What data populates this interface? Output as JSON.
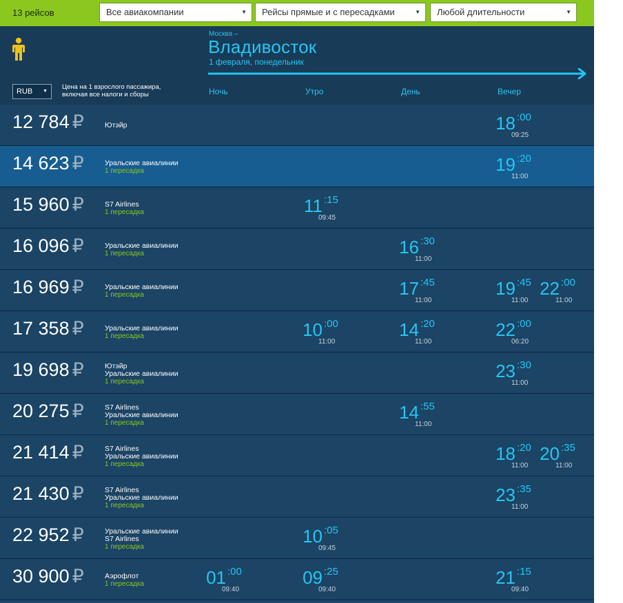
{
  "filters": {
    "count": "13 рейсов",
    "airlines": "Все авиакомпании",
    "stops": "Рейсы прямые и с пересадками",
    "duration": "Любой длительности"
  },
  "header": {
    "from": "Москва –",
    "to": "Владивосток",
    "date": "1 февраля, понедельник",
    "currency": "RUB",
    "price_note_line1": "Цена на 1 взрослого пассажира,",
    "price_note_line2": "включая все налоги и сборы",
    "columns": [
      "Ночь",
      "Утро",
      "День",
      "Вечер"
    ]
  },
  "colors": {
    "accent": "#27c5f2",
    "bar": "#8cc71f",
    "row": "#1b4465",
    "row_selected": "#175d91"
  },
  "icons": {
    "passenger": "person-icon",
    "timeline": "arrow-right-icon",
    "dropdown": "triangle-down-icon"
  },
  "flights": [
    {
      "price": "12 784",
      "rub": "₽",
      "airlines": [
        "Ютэйр"
      ],
      "transfer": "",
      "selected": false,
      "times": [
        {
          "col": 3,
          "h": "18",
          "m": ":00",
          "d": "09:25"
        }
      ]
    },
    {
      "price": "14 623",
      "rub": "₽",
      "airlines": [
        "Уральские авиалинии"
      ],
      "transfer": "1 пересадка",
      "selected": true,
      "times": [
        {
          "col": 3,
          "h": "19",
          "m": ":20",
          "d": "11:00"
        }
      ]
    },
    {
      "price": "15 960",
      "rub": "₽",
      "airlines": [
        "S7 Airlines"
      ],
      "transfer": "1 пересадка",
      "selected": false,
      "times": [
        {
          "col": 1,
          "h": "11",
          "m": ":15",
          "d": "09:45"
        }
      ]
    },
    {
      "price": "16 096",
      "rub": "₽",
      "airlines": [
        "Уральские авиалинии"
      ],
      "transfer": "1 пересадка",
      "selected": false,
      "times": [
        {
          "col": 2,
          "h": "16",
          "m": ":30",
          "d": "11:00"
        }
      ]
    },
    {
      "price": "16 969",
      "rub": "₽",
      "airlines": [
        "Уральские авиалинии"
      ],
      "transfer": "1 пересадка",
      "selected": false,
      "times": [
        {
          "col": 2,
          "h": "17",
          "m": ":45",
          "d": "11:00"
        },
        {
          "col": 3,
          "h": "19",
          "m": ":45",
          "d": "11:00"
        },
        {
          "col": 4,
          "h": "22",
          "m": ":00",
          "d": "11:00"
        }
      ]
    },
    {
      "price": "17 358",
      "rub": "₽",
      "airlines": [
        "Уральские авиалинии"
      ],
      "transfer": "1 пересадка",
      "selected": false,
      "times": [
        {
          "col": 1,
          "h": "10",
          "m": ":00",
          "d": "11:00"
        },
        {
          "col": 2,
          "h": "14",
          "m": ":20",
          "d": "11:00"
        },
        {
          "col": 3,
          "h": "22",
          "m": ":00",
          "d": "06:20"
        }
      ]
    },
    {
      "price": "19 698",
      "rub": "₽",
      "airlines": [
        "Ютэйр",
        "Уральские авиалинии"
      ],
      "transfer": "1 пересадка",
      "selected": false,
      "times": [
        {
          "col": 3,
          "h": "23",
          "m": ":30",
          "d": "11:00"
        }
      ]
    },
    {
      "price": "20 275",
      "rub": "₽",
      "airlines": [
        "S7 Airlines",
        "Уральские авиалинии"
      ],
      "transfer": "1 пересадка",
      "selected": false,
      "times": [
        {
          "col": 2,
          "h": "14",
          "m": ":55",
          "d": "11:00"
        }
      ]
    },
    {
      "price": "21 414",
      "rub": "₽",
      "airlines": [
        "S7 Airlines",
        "Уральские авиалинии"
      ],
      "transfer": "1 пересадка",
      "selected": false,
      "times": [
        {
          "col": 3,
          "h": "18",
          "m": ":20",
          "d": "11:00"
        },
        {
          "col": 4,
          "h": "20",
          "m": ":35",
          "d": "11:00"
        }
      ]
    },
    {
      "price": "21 430",
      "rub": "₽",
      "airlines": [
        "S7 Airlines",
        "Уральские авиалинии"
      ],
      "transfer": "1 пересадка",
      "selected": false,
      "times": [
        {
          "col": 3,
          "h": "23",
          "m": ":35",
          "d": "11:00"
        }
      ]
    },
    {
      "price": "22 952",
      "rub": "₽",
      "airlines": [
        "Уральские авиалинии",
        "S7 Airlines"
      ],
      "transfer": "1 пересадка",
      "selected": false,
      "times": [
        {
          "col": 1,
          "h": "10",
          "m": ":05",
          "d": "09:45"
        }
      ]
    },
    {
      "price": "30 900",
      "rub": "₽",
      "airlines": [
        "Аэрофлот"
      ],
      "transfer": "1 пересадка",
      "selected": false,
      "times": [
        {
          "col": 0,
          "h": "01",
          "m": ":00",
          "d": "09:40"
        },
        {
          "col": 1,
          "h": "09",
          "m": ":25",
          "d": "09:40"
        },
        {
          "col": 3,
          "h": "21",
          "m": ":15",
          "d": "09:40"
        }
      ]
    }
  ]
}
